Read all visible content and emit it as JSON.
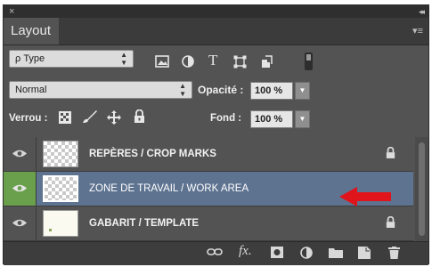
{
  "panel": {
    "title": "Layout",
    "close_glyph": "×",
    "collapse_glyph": "◂◂",
    "menu_glyph": "▾≡"
  },
  "filter": {
    "kind_label": "ρ Type",
    "icons": [
      "image-filter-icon",
      "adjustment-filter-icon",
      "type-filter-icon",
      "shape-filter-icon",
      "smart-object-filter-icon"
    ]
  },
  "blend": {
    "mode": "Normal",
    "opacity_label": "Opacité :",
    "opacity_value": "100 %"
  },
  "lock": {
    "label": "Verrou :",
    "fill_label": "Fond :",
    "fill_value": "100 %"
  },
  "layers": [
    {
      "name": "REPÈRES / CROP MARKS",
      "locked": true,
      "selected": false
    },
    {
      "name": "ZONE DE TRAVAIL / WORK AREA",
      "locked": false,
      "selected": true
    },
    {
      "name": "GABARIT / TEMPLATE",
      "locked": true,
      "selected": false
    }
  ],
  "bottom_icons": [
    "link-icon",
    "fx-icon",
    "mask-icon",
    "adjustment-icon",
    "folder-icon",
    "new-layer-icon",
    "trash-icon"
  ],
  "bottom": {
    "fx_label": "fx."
  },
  "colors": {
    "panel_bg": "#535353",
    "selected_row": "#5e7390",
    "visible_eye_bg": "#6aa04c",
    "arrow": "#e0151b"
  }
}
